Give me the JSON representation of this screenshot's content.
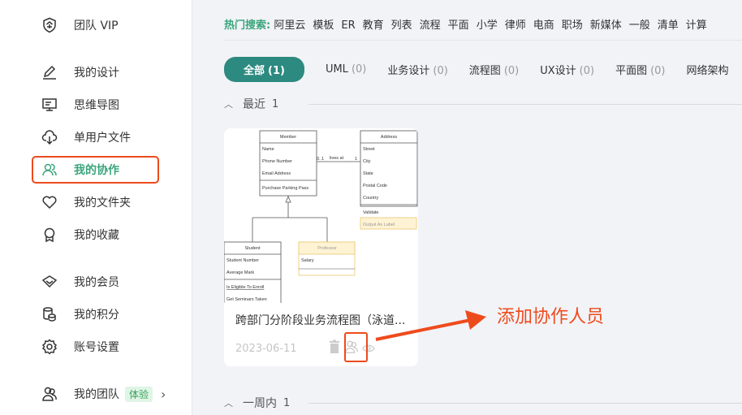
{
  "sidebar": {
    "items": [
      {
        "label": "团队 VIP",
        "icon": "enterprise-shield-icon"
      },
      {
        "label": "我的设计",
        "icon": "pencil-icon"
      },
      {
        "label": "思维导图",
        "icon": "monitor-icon"
      },
      {
        "label": "单用户文件",
        "icon": "cloud-download-icon"
      },
      {
        "label": "我的协作",
        "icon": "users-icon",
        "active": true
      },
      {
        "label": "我的文件夹",
        "icon": "heart-icon"
      },
      {
        "label": "我的收藏",
        "icon": "award-icon"
      },
      {
        "label": "我的会员",
        "icon": "diamond-icon"
      },
      {
        "label": "我的积分",
        "icon": "coins-icon"
      },
      {
        "label": "账号设置",
        "icon": "gear-icon"
      },
      {
        "label": "我的团队",
        "icon": "team-icon",
        "badge": "体验"
      }
    ]
  },
  "hot_search": {
    "label": "热门搜索:",
    "keywords": [
      "阿里云",
      "模板",
      "ER",
      "教育",
      "列表",
      "流程",
      "平面",
      "小学",
      "律师",
      "电商",
      "职场",
      "新媒体",
      "一般",
      "清单",
      "计算"
    ]
  },
  "tabs": [
    {
      "label": "全部",
      "count": "(1)",
      "active": true
    },
    {
      "label": "UML",
      "count": "(0)"
    },
    {
      "label": "业务设计",
      "count": "(0)"
    },
    {
      "label": "流程图",
      "count": "(0)"
    },
    {
      "label": "UX设计",
      "count": "(0)"
    },
    {
      "label": "平面图",
      "count": "(0)"
    },
    {
      "label": "网络架构",
      "count": ""
    }
  ],
  "sections": [
    {
      "label": "最近",
      "count": "1"
    },
    {
      "label": "一周内",
      "count": "1"
    }
  ],
  "card": {
    "title": "跨部门分阶段业务流程图（泳道...",
    "date": "2023-06-11",
    "thumbnail": {
      "member": {
        "title": "Member",
        "fields": [
          "Name",
          "Phone Number",
          "Email Address"
        ],
        "methods": [
          "Purchase Parking Pass"
        ]
      },
      "address": {
        "title": "Address",
        "fields": [
          "Street",
          "City",
          "State",
          "Postal Code",
          "Country"
        ],
        "methods": [
          "Validate",
          "Output As Label"
        ]
      },
      "association": {
        "label": "lives at",
        "from": "0..1",
        "to": "1"
      },
      "student": {
        "title": "Student",
        "fields": [
          "Student Number",
          "Average Mark"
        ],
        "methods": [
          "Is Eligible To Enroll",
          "Get Seminars Taken"
        ]
      },
      "professor": {
        "title": "Professor",
        "fields": [
          "Salary"
        ]
      }
    }
  },
  "annotation": "添加协作人员",
  "colors": {
    "accent": "#3aa57a",
    "tab_active": "#2d8a80",
    "highlight": "#ee4b1d",
    "background": "#f2f3f7"
  }
}
